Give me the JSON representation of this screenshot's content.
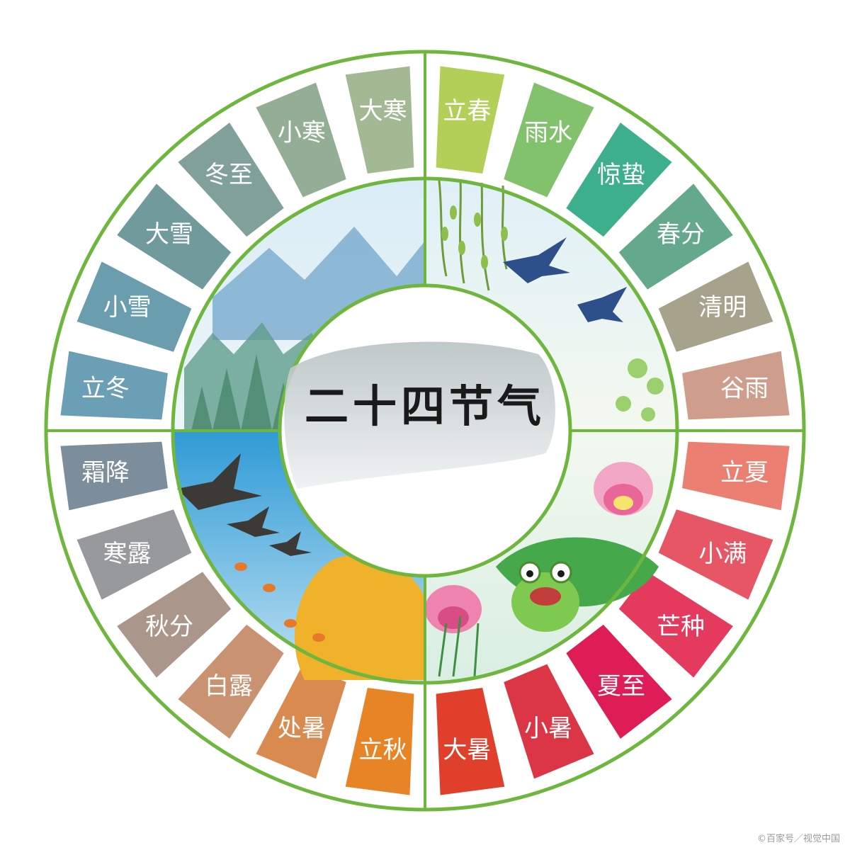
{
  "title": "二十四节气",
  "credit": "©百家号／视觉中国",
  "colors": {
    "ring": "#6fb63f",
    "divider": "#6fb63f"
  },
  "terms": [
    {
      "label": "立春",
      "color": "#b2cf58"
    },
    {
      "label": "雨水",
      "color": "#82c26d"
    },
    {
      "label": "惊蛰",
      "color": "#3daf8b"
    },
    {
      "label": "春分",
      "color": "#65a98c"
    },
    {
      "label": "清明",
      "color": "#a6a28c"
    },
    {
      "label": "谷雨",
      "color": "#cf9d8c"
    },
    {
      "label": "立夏",
      "color": "#ea7f72"
    },
    {
      "label": "小满",
      "color": "#e65665"
    },
    {
      "label": "芒种",
      "color": "#e33a5d"
    },
    {
      "label": "夏至",
      "color": "#de1c56"
    },
    {
      "label": "小暑",
      "color": "#db3646"
    },
    {
      "label": "大暑",
      "color": "#e0402b"
    },
    {
      "label": "立秋",
      "color": "#e78425"
    },
    {
      "label": "处暑",
      "color": "#d98a4f"
    },
    {
      "label": "白露",
      "color": "#c99270"
    },
    {
      "label": "秋分",
      "color": "#aa968a"
    },
    {
      "label": "寒露",
      "color": "#98999d"
    },
    {
      "label": "霜降",
      "color": "#7c8e9c"
    },
    {
      "label": "立冬",
      "color": "#6a9fb5"
    },
    {
      "label": "小雪",
      "color": "#6a9dae"
    },
    {
      "label": "大雪",
      "color": "#719a9c"
    },
    {
      "label": "冬至",
      "color": "#81a09a"
    },
    {
      "label": "小寒",
      "color": "#94ad95"
    },
    {
      "label": "大寒",
      "color": "#a3b993"
    }
  ]
}
